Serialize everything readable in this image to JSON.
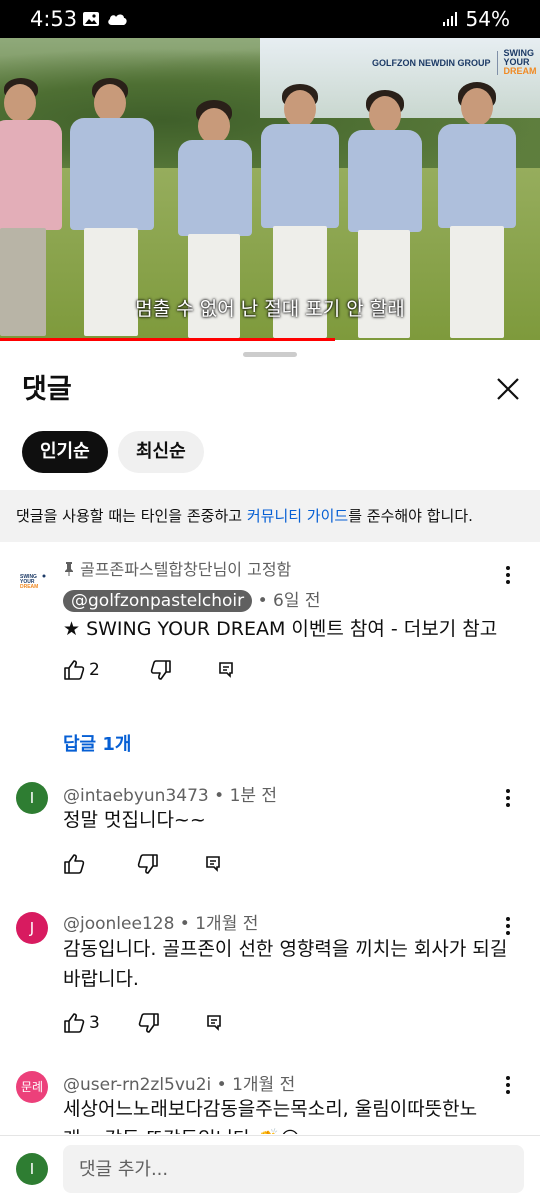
{
  "status_bar": {
    "time": "4:53",
    "battery": "54%"
  },
  "video": {
    "brand_name": "GOLFZON NEWDIN GROUP",
    "brand_logo_lines": [
      "SWING",
      "YOUR",
      "DREAM"
    ],
    "subtitle": "멈출 수 없어 난 절대 포기 안 할래",
    "progress": 0.62
  },
  "panel": {
    "title": "댓글",
    "sort_chips": [
      "인기순",
      "최신순"
    ],
    "guide_prefix": "댓글을 사용할 때는 타인을 존중하고 ",
    "guide_link": "커뮤니티 가이드",
    "guide_suffix": "를 준수해야 합니다."
  },
  "comments": [
    {
      "pinned_by": "골프존파스텔합창단님이 고정함",
      "author": "@golfzonpastelchoir",
      "time": "6일 전",
      "text": "★ SWING YOUR DREAM 이벤트 참여 - 더보기 참고",
      "likes": "2",
      "reply_link": "답글 1개"
    },
    {
      "avatar_letter": "I",
      "avatar_color": "#2e7d32",
      "author": "@intaebyun3473",
      "time": "1분 전",
      "text": "정말 멋집니다~~"
    },
    {
      "avatar_letter": "J",
      "avatar_color": "#d81b60",
      "author": "@joonlee128",
      "time": "1개월 전",
      "text": "감동입니다. 골프존이 선한 영향력을 끼치는 회사가 되길 바랍니다.",
      "likes": "3"
    },
    {
      "avatar_letter": "문례",
      "avatar_color": "#ec407a",
      "author": "@user-rn2zl5vu2i",
      "time": "1개월 전",
      "text": "세상어느노래보다감동을주는목소리, 울림이따뜻한노래... 감동 또감동입니다 👏😢"
    }
  ],
  "composer": {
    "avatar_letter": "I",
    "placeholder": "댓글 추가..."
  }
}
